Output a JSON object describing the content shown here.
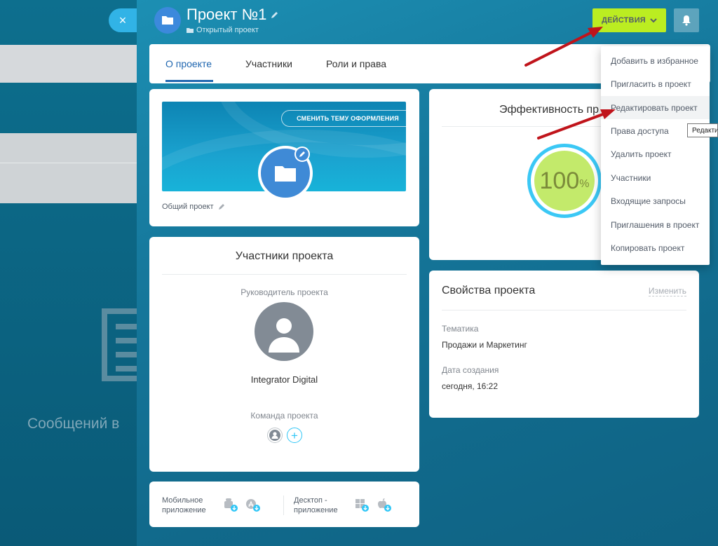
{
  "background": {
    "message_text": "Сообщений в"
  },
  "close_button": {
    "glyph": "×"
  },
  "header": {
    "title": "Проект №1",
    "subtitle": "Открытый проект",
    "actions_label": "ДЕЙСТВИЯ"
  },
  "tabs": [
    {
      "label": "О проекте",
      "active": true
    },
    {
      "label": "Участники",
      "active": false
    },
    {
      "label": "Роли и права",
      "active": false
    }
  ],
  "about_card": {
    "theme_button": "СМЕНИТЬ ТЕМУ ОФОРМЛЕНИЯ",
    "project_type": "Общий проект"
  },
  "efficiency_card": {
    "title": "Эффективность пр",
    "value": "100",
    "unit": "%"
  },
  "members_card": {
    "title": "Участники проекта",
    "head_label": "Руководитель проекта",
    "head_name": "Integrator Digital",
    "team_label": "Команда проекта"
  },
  "properties_card": {
    "title": "Свойства проекта",
    "edit_link": "Изменить",
    "topic_label": "Тематика",
    "topic_value": "Продажи и Маркетинг",
    "created_label": "Дата создания",
    "created_value": "сегодня, 16:22"
  },
  "apps_card": {
    "mobile_label_1": "Мобильное",
    "mobile_label_2": "приложение",
    "desktop_label_1": "Десктоп -",
    "desktop_label_2": "приложение"
  },
  "actions_menu": {
    "items": [
      "Добавить в избранное",
      "Пригласить в проект",
      "Редактировать проект",
      "Права доступа",
      "Удалить проект",
      "Участники",
      "Входящие запросы",
      "Приглашения в проект",
      "Копировать проект"
    ],
    "hovered_index": 2
  },
  "tooltip": {
    "text": "Редакти"
  },
  "colors": {
    "actions_button": "#bbed21",
    "annotation_arrow": "#c0141b",
    "link_active": "#2067b0",
    "gauge_fill": "#c3ea6b",
    "gauge_ring": "#3bc8f5"
  },
  "icons": [
    "close-icon",
    "folder-icon",
    "pencil-icon",
    "chevron-down-icon",
    "bell-icon",
    "user-icon",
    "plus-icon",
    "android-icon",
    "appstore-icon",
    "windows-icon",
    "apple-icon",
    "download-badge-icon"
  ]
}
